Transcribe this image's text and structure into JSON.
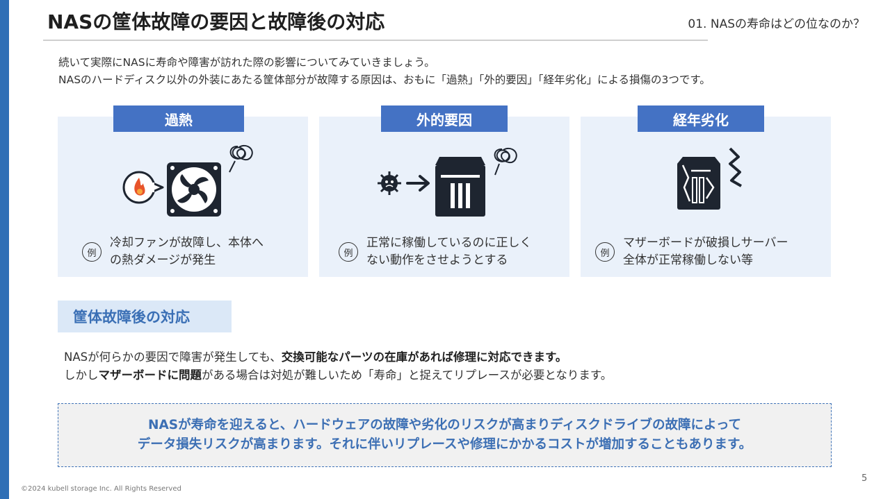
{
  "header": {
    "title": "NASの筐体故障の要因と故障後の対応",
    "section": "01. NASの寿命はどの位なのか？"
  },
  "intro": {
    "line1": "続いて実際にNASに寿命や障害が訪れた際の影響についてみていきましょう。",
    "line2": "NASのハードディスク以外の外装にあたる筐体部分が故障する原因は、おもに「過熱」「外的要因」「経年劣化」による損傷の3つです。"
  },
  "cards": [
    {
      "label": "過熱",
      "icon": "fan-overheat-icon",
      "example_mark": "例",
      "example_lines": [
        "冷却ファンが故障し、本体へ",
        "の熱ダメージが発生"
      ]
    },
    {
      "label": "外的要因",
      "icon": "virus-to-nas-icon",
      "example_mark": "例",
      "example_lines": [
        "正常に稼働しているのに正しく",
        "ない動作をさせようとする"
      ]
    },
    {
      "label": "経年劣化",
      "icon": "broken-board-icon",
      "example_mark": "例",
      "example_lines": [
        "マザーボードが破損しサーバー",
        "全体が正常稼働しない等"
      ]
    }
  ],
  "response": {
    "label": "筐体故障後の対応",
    "line1_a": "NASが何らかの要因で障害が発生しても、",
    "line1_b": "交換可能なパーツの在庫があれば修理に対応できます。",
    "line2_a": "しかし",
    "line2_b": "マザーボードに問題",
    "line2_c": "がある場合は対処が難しいため「寿命」と捉えてリプレースが必要となります。"
  },
  "callout": {
    "line1": "NASが寿命を迎えると、ハードウェアの故障や劣化のリスクが高まりディスクドライブの故障によって",
    "line2": "データ損失リスクが高まります。それに伴いリプレースや修理にかかるコストが増加することもあります。"
  },
  "footer": {
    "copyright": "©2024 kubell storage Inc. All Rights Reserved",
    "page": "5"
  },
  "colors": {
    "accent": "#4472c4",
    "sidebar": "#2f6fb6",
    "card_bg": "#eaf1fa",
    "callout_text": "#3c6fb4"
  }
}
